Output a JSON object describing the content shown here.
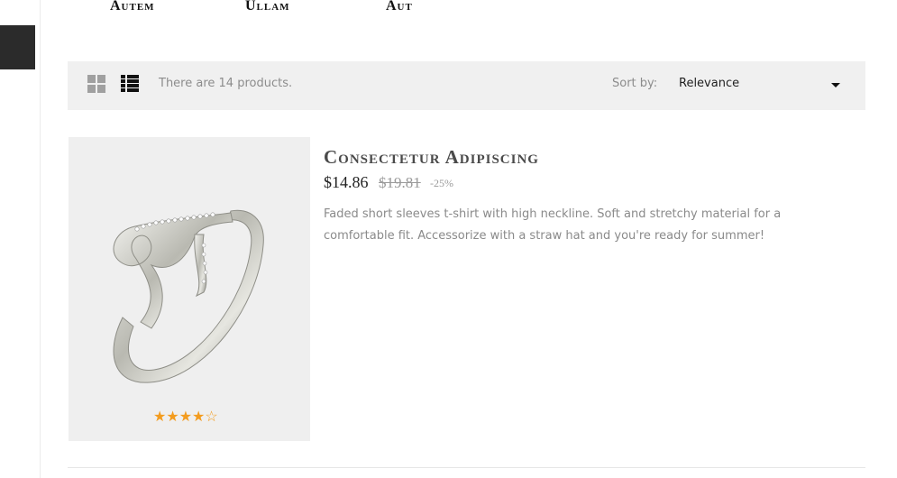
{
  "top_nav": {
    "items": [
      {
        "label": "Autem"
      },
      {
        "label": "Ullam"
      },
      {
        "label": "Aut"
      }
    ]
  },
  "toolbar": {
    "grid_view_icon": "grid-icon",
    "list_view_icon": "list-icon",
    "product_count_text": "There are 14 products.",
    "sort_label": "Sort by:",
    "sort_value": "Relevance"
  },
  "product": {
    "name": "Consectetur Adipiscing",
    "price": "$14.86",
    "regular_price": "$19.81",
    "discount": "-25%",
    "description": "Faded short sleeves t-shirt with high neckline. Soft and stretchy material for a comfortable fit. Accessorize with a straw hat and you're ready for summer!",
    "rating": {
      "value": 4,
      "max": 5
    },
    "image_alt": "ring-image"
  },
  "colors": {
    "toolbar_bg": "#f0f0f0",
    "star": "#f39c1f",
    "dark_tab": "#2b2b2b"
  }
}
